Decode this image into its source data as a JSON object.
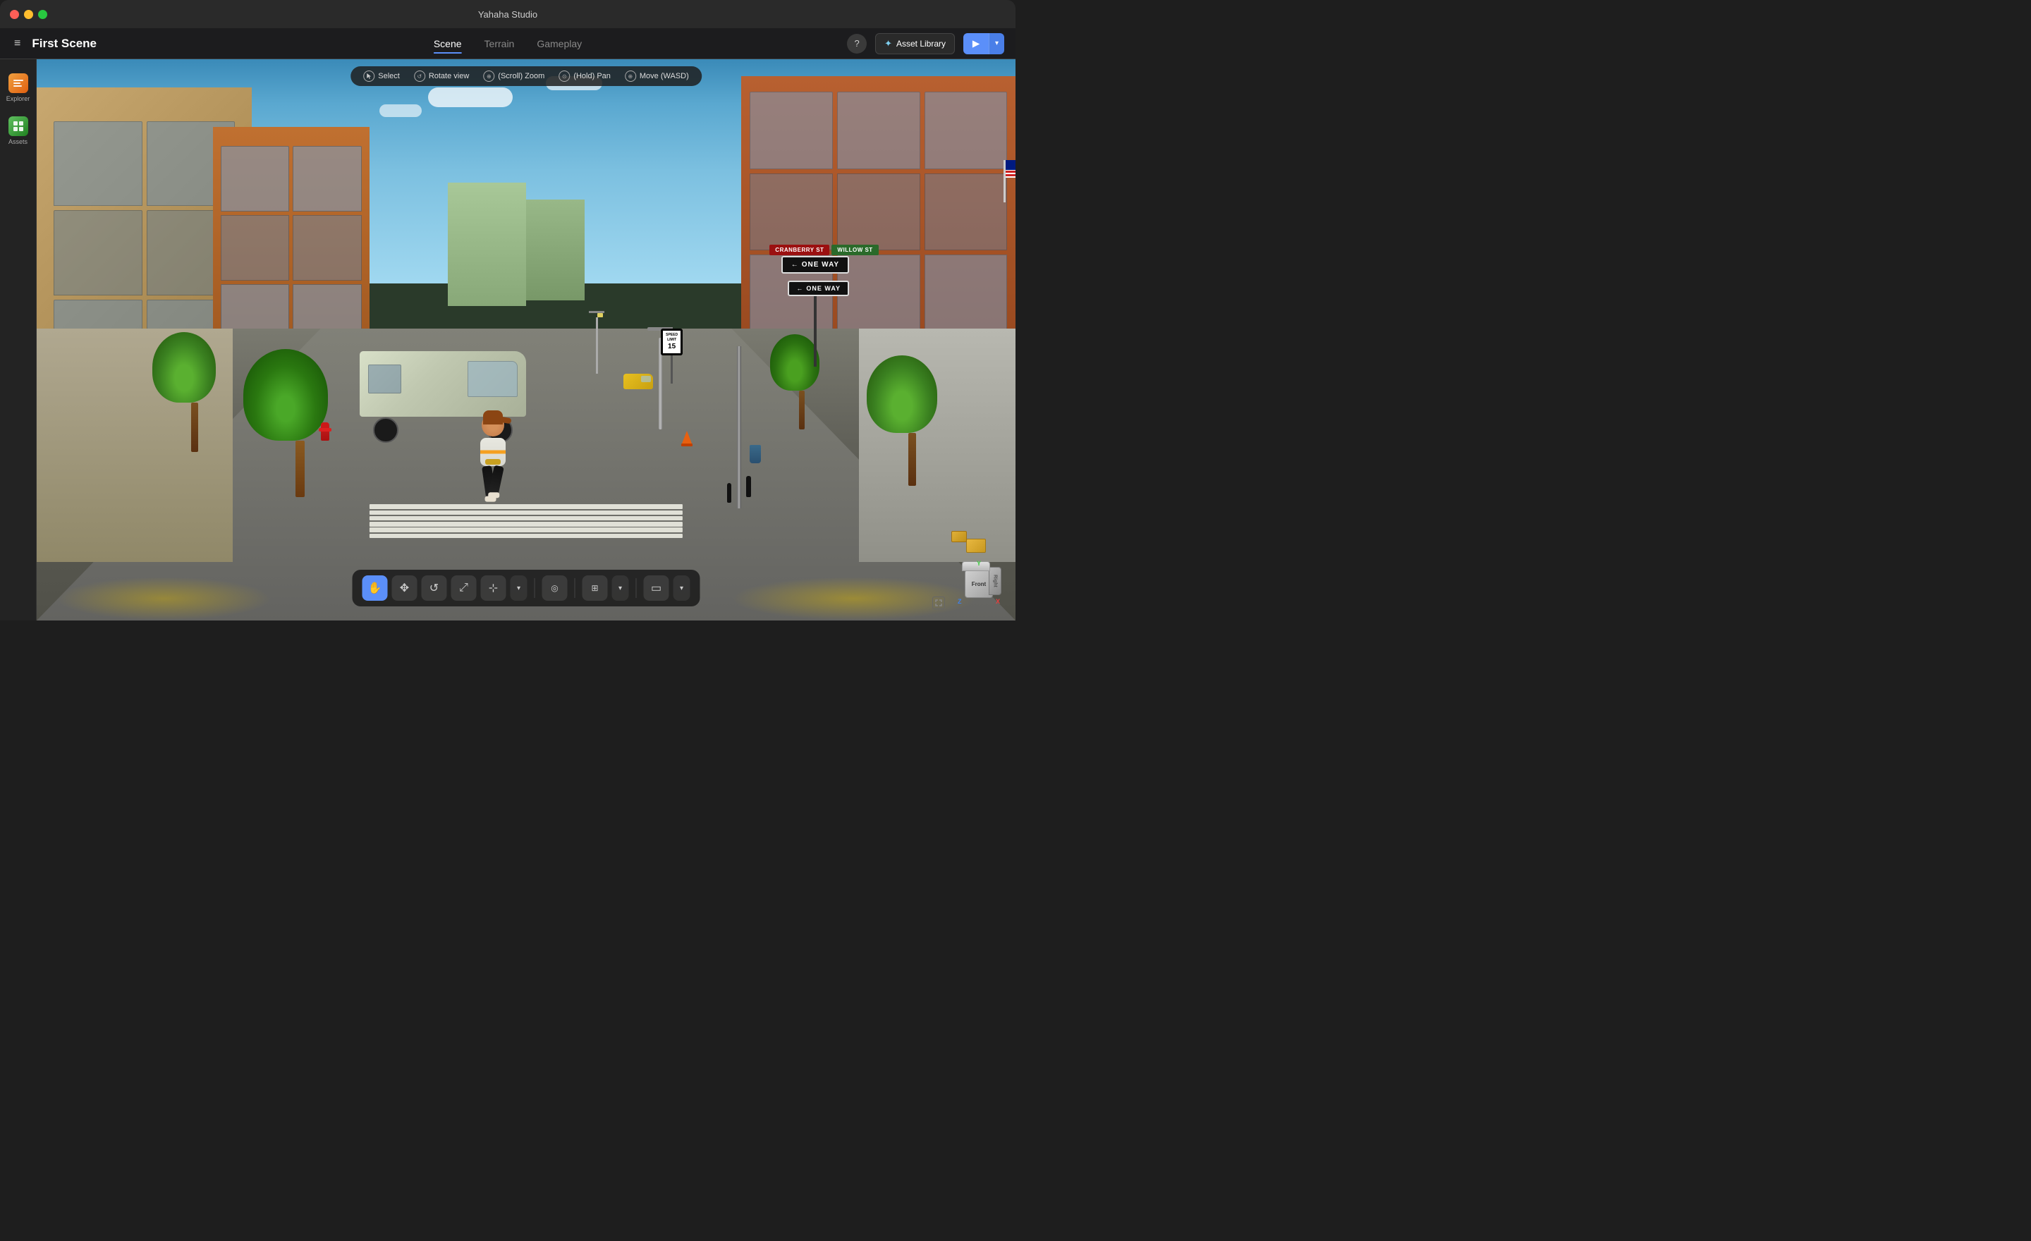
{
  "window": {
    "title": "Yahaha Studio"
  },
  "titlebar": {
    "title": "Yahaha Studio",
    "traffic_lights": [
      "red",
      "yellow",
      "green"
    ]
  },
  "menubar": {
    "scene_title": "First Scene",
    "tabs": [
      {
        "label": "Scene",
        "active": true
      },
      {
        "label": "Terrain",
        "active": false
      },
      {
        "label": "Gameplay",
        "active": false
      }
    ],
    "help_icon": "?",
    "asset_library_label": "Asset Library",
    "play_button": "▶",
    "play_dropdown": "▾"
  },
  "sidebar": {
    "items": [
      {
        "label": "Explorer",
        "icon": "explorer-icon"
      },
      {
        "label": "Assets",
        "icon": "assets-icon"
      }
    ]
  },
  "viewport": {
    "toolbar": {
      "items": [
        {
          "icon": "cursor-icon",
          "label": "Select"
        },
        {
          "icon": "rotate-icon",
          "label": "Rotate view"
        },
        {
          "icon": "zoom-icon",
          "label": "(Scroll) Zoom"
        },
        {
          "icon": "pan-icon",
          "label": "(Hold) Pan"
        },
        {
          "icon": "move-icon",
          "label": "Move (WASD)"
        }
      ]
    },
    "bottom_tools": [
      {
        "icon": "✋",
        "active": true,
        "label": "hand-tool"
      },
      {
        "icon": "✥",
        "active": false,
        "label": "move-tool"
      },
      {
        "icon": "↺",
        "active": false,
        "label": "rotate-tool"
      },
      {
        "icon": "⤢",
        "active": false,
        "label": "scale-tool"
      },
      {
        "icon": "⊹",
        "active": false,
        "label": "transform-tool"
      },
      {
        "icon": "◎",
        "active": false,
        "label": "snap-tool"
      },
      {
        "icon": "⊞",
        "active": false,
        "label": "grid-tool"
      },
      {
        "icon": "▭",
        "active": false,
        "label": "view-tool"
      }
    ],
    "gizmo": {
      "front_label": "Front",
      "right_label": "Right",
      "axes": [
        "X",
        "Y",
        "Z"
      ]
    }
  },
  "scene": {
    "street_signs": {
      "cranberry": "CRANBERRY ST",
      "willow": "WILLOW ST",
      "one_way_1": "ONE WAY",
      "one_way_2": "ONE WAY",
      "speed_limit": "SPEED\nLIMIT\n15"
    },
    "objects": [
      "character",
      "van",
      "trees",
      "buildings",
      "lamppost",
      "hydrant",
      "traffic_cone",
      "bollards",
      "taxi"
    ]
  }
}
